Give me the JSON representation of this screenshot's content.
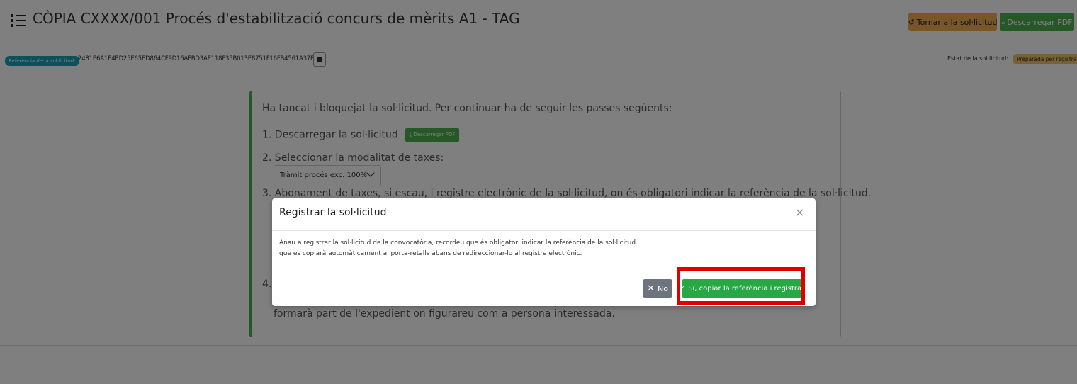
{
  "header": {
    "title": "CÒPIA CXXXX/001 Procés d'estabilització concurs de mèrits A1 - TAG",
    "back_button": "Tornar a la sol·licitud",
    "pdf_button": "Descarregar PDF"
  },
  "reference": {
    "badge": "Referència de la sol·licitud:",
    "code": "2481E6A1E4ED25E65ED864CF9D16AFBD3AE118F35B013E8751F16FB4561A37EC",
    "state_label": "Estat de la sol·licitud:",
    "state_badge": "Preparada per registrar"
  },
  "card": {
    "intro": "Ha tancat i bloquejat la sol·licitud. Per continuar ha de seguir les passes següents:",
    "step1": "1. Descarregar la sol·licitud",
    "step1_button": "Descarregar PDF",
    "step2": "2. Seleccionar la modalitat de taxes:",
    "tax_option": "Tràmit procés exc. 100%",
    "step3": "3. Abonament de taxes, si escau, i registre electrònic de la sol·licitud, on és obligatori indicar la referència de la sol·licitud.",
    "step4": "4.",
    "step4_cont": "formarà part de l'expedient on figurareu com a persona interessada."
  },
  "modal": {
    "title": "Registrar la sol·licitud",
    "line1": "Anau a registrar la sol·licitud de la convocatòria, recordeu que és obligatori indicar la referència de la sol·licitud.",
    "line2": "que es copiarà automàticament al porta-retalls abans de redireccionar-lo al registre electrònic.",
    "no_button": "No",
    "yes_button": "Sí, copiar la referència i registrar",
    "close_symbol": "×"
  },
  "icons": {
    "title_icon": "list-icon",
    "back_icon": "undo-icon",
    "download_icon": "download-icon",
    "copy_icon": "clipboard-icon",
    "no_icon": "close-icon",
    "yes_icon": "check-icon"
  },
  "colors": {
    "warning": "#f0ad4e",
    "success": "#28a745",
    "info": "#17a2b8",
    "secondary": "#6c757d",
    "highlight": "#e00000"
  }
}
